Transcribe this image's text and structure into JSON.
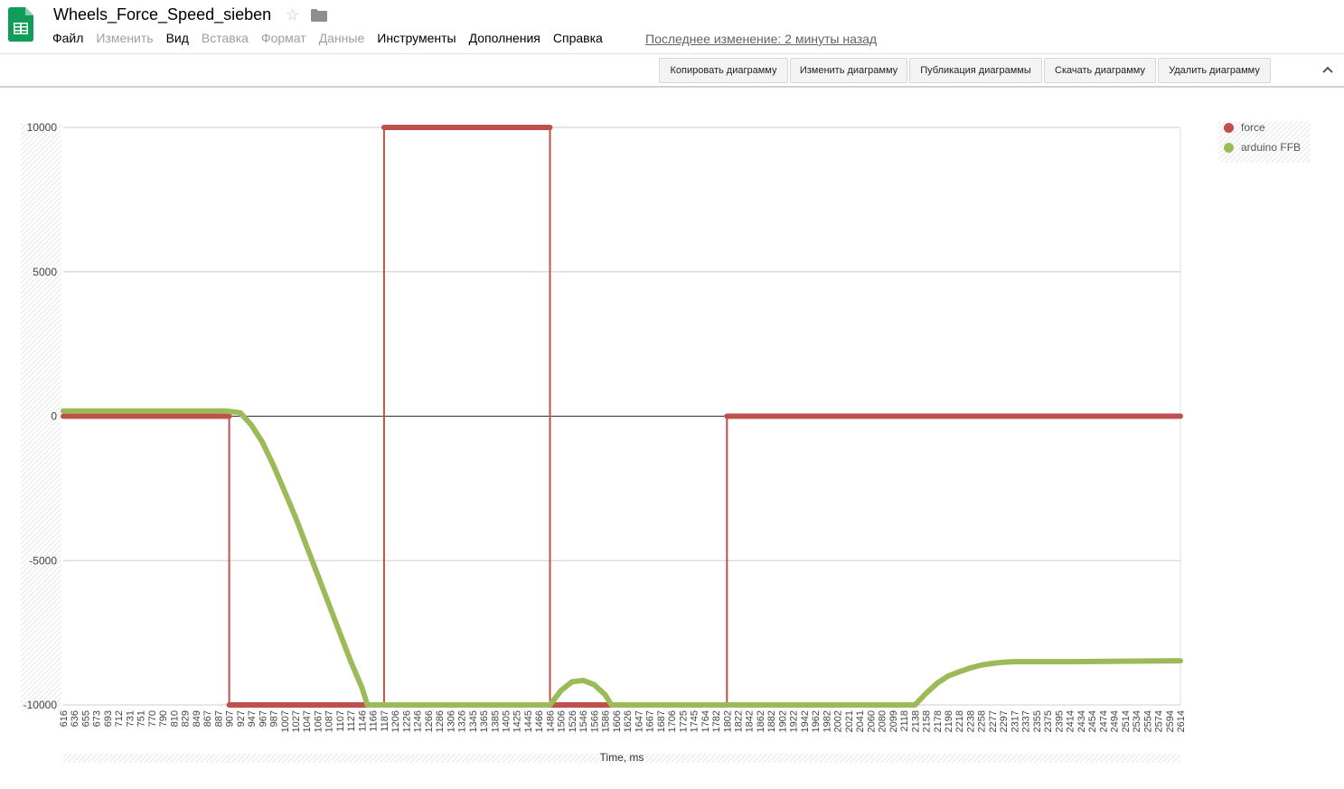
{
  "doc": {
    "title": "Wheels_Force_Speed_sieben",
    "last_edit": "Последнее изменение: 2 минуты назад"
  },
  "icons": {
    "logo": "sheets-logo-icon",
    "star": "star-icon",
    "folder": "folder-icon",
    "collapse": "chevron-up-icon"
  },
  "colors": {
    "sheets_green": "#0f9d58",
    "force": "#c0504d",
    "ffb": "#9bbb59"
  },
  "menu": [
    {
      "label": "Файл",
      "enabled": true
    },
    {
      "label": "Изменить",
      "enabled": false
    },
    {
      "label": "Вид",
      "enabled": true
    },
    {
      "label": "Вставка",
      "enabled": false
    },
    {
      "label": "Формат",
      "enabled": false
    },
    {
      "label": "Данные",
      "enabled": false
    },
    {
      "label": "Инструменты",
      "enabled": true
    },
    {
      "label": "Дополнения",
      "enabled": true
    },
    {
      "label": "Справка",
      "enabled": true
    }
  ],
  "toolbar": {
    "copy": "Копировать диаграмму",
    "edit": "Изменить диаграмму",
    "publish": "Публикация диаграммы",
    "download": "Скачать диаграмму",
    "delete": "Удалить диаграмму"
  },
  "chart_data": {
    "type": "line",
    "xlabel": "Time, ms",
    "ylim": [
      -10000,
      10000
    ],
    "yticks": [
      10000,
      5000,
      0,
      -5000,
      -10000
    ],
    "grid": true,
    "legend_position": "right",
    "x_ticks": [
      "616",
      "636",
      "655",
      "673",
      "693",
      "712",
      "731",
      "751",
      "770",
      "790",
      "810",
      "829",
      "849",
      "867",
      "887",
      "907",
      "927",
      "947",
      "967",
      "987",
      "1007",
      "1027",
      "1047",
      "1067",
      "1087",
      "1107",
      "1127",
      "1146",
      "1166",
      "1187",
      "1206",
      "1226",
      "1246",
      "1266",
      "1286",
      "1306",
      "1326",
      "1345",
      "1365",
      "1385",
      "1405",
      "1425",
      "1445",
      "1466",
      "1486",
      "1506",
      "1526",
      "1546",
      "1566",
      "1586",
      "1606",
      "1626",
      "1647",
      "1667",
      "1687",
      "1706",
      "1725",
      "1745",
      "1764",
      "1782",
      "1802",
      "1822",
      "1842",
      "1862",
      "1882",
      "1902",
      "1922",
      "1942",
      "1962",
      "1982",
      "2002",
      "2021",
      "2041",
      "2060",
      "2080",
      "2099",
      "2118",
      "2138",
      "2158",
      "2178",
      "2198",
      "2218",
      "2238",
      "2258",
      "2277",
      "2297",
      "2317",
      "2337",
      "2355",
      "2375",
      "2395",
      "2414",
      "2434",
      "2454",
      "2474",
      "2494",
      "2514",
      "2534",
      "2554",
      "2574",
      "2594",
      "2614"
    ],
    "series": [
      {
        "name": "force",
        "color": "#c0504d",
        "points": [
          [
            616,
            0
          ],
          [
            907,
            0
          ],
          [
            907,
            -10000
          ],
          [
            1187,
            -10000
          ],
          [
            1187,
            10000
          ],
          [
            1486,
            10000
          ],
          [
            1486,
            -10000
          ],
          [
            1802,
            -10000
          ],
          [
            1802,
            0
          ],
          [
            2614,
            0
          ]
        ]
      },
      {
        "name": "arduino FFB",
        "color": "#9bbb59",
        "points": [
          [
            616,
            180
          ],
          [
            900,
            180
          ],
          [
            927,
            120
          ],
          [
            947,
            -300
          ],
          [
            967,
            -900
          ],
          [
            987,
            -1700
          ],
          [
            1007,
            -2600
          ],
          [
            1027,
            -3500
          ],
          [
            1047,
            -4500
          ],
          [
            1067,
            -5500
          ],
          [
            1087,
            -6500
          ],
          [
            1107,
            -7500
          ],
          [
            1127,
            -8500
          ],
          [
            1146,
            -9400
          ],
          [
            1156,
            -10000
          ],
          [
            1486,
            -10000
          ],
          [
            1506,
            -9500
          ],
          [
            1526,
            -9200
          ],
          [
            1546,
            -9150
          ],
          [
            1566,
            -9300
          ],
          [
            1586,
            -9650
          ],
          [
            1597,
            -10000
          ],
          [
            2138,
            -10000
          ],
          [
            2158,
            -9600
          ],
          [
            2178,
            -9250
          ],
          [
            2198,
            -9000
          ],
          [
            2218,
            -8850
          ],
          [
            2238,
            -8720
          ],
          [
            2258,
            -8620
          ],
          [
            2277,
            -8560
          ],
          [
            2297,
            -8520
          ],
          [
            2317,
            -8500
          ],
          [
            2414,
            -8500
          ],
          [
            2614,
            -8470
          ]
        ]
      }
    ]
  }
}
